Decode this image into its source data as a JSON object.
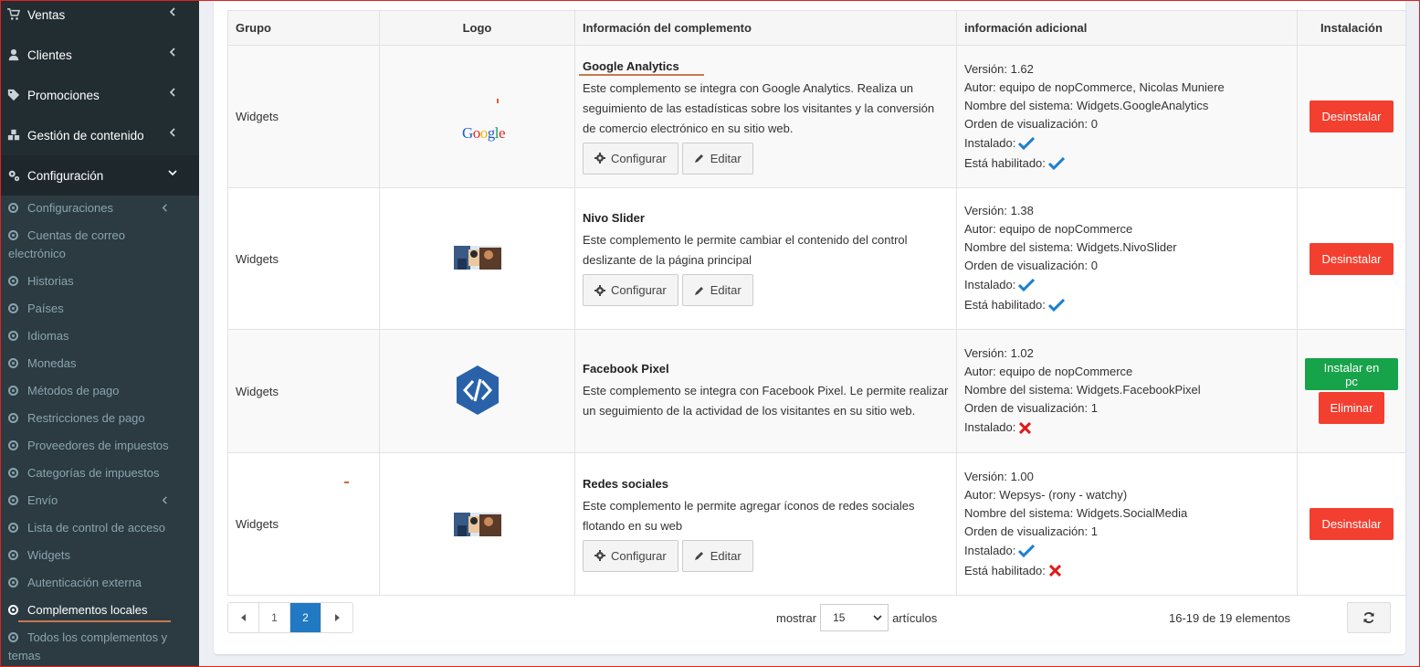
{
  "sidebar": {
    "top_items": [
      {
        "label": "Ventas",
        "icon": "cart-icon"
      },
      {
        "label": "Clientes",
        "icon": "user-icon"
      },
      {
        "label": "Promociones",
        "icon": "tag-icon"
      },
      {
        "label": "Gestión de contenido",
        "icon": "cubes-icon"
      },
      {
        "label": "Configuración",
        "icon": "gears-icon"
      }
    ],
    "sub_items": [
      {
        "label": "Configuraciones"
      },
      {
        "label": "Cuentas de correo electrónico"
      },
      {
        "label": "Historias"
      },
      {
        "label": "Países"
      },
      {
        "label": "Idiomas"
      },
      {
        "label": "Monedas"
      },
      {
        "label": "Métodos de pago"
      },
      {
        "label": "Restricciones de pago"
      },
      {
        "label": "Proveedores de impuestos"
      },
      {
        "label": "Categorías de impuestos"
      },
      {
        "label": "Envío"
      },
      {
        "label": "Lista de control de acceso"
      },
      {
        "label": "Widgets"
      },
      {
        "label": "Autenticación externa"
      },
      {
        "label": "Complementos locales"
      },
      {
        "label": "Todos los complementos y temas"
      }
    ]
  },
  "table": {
    "headers": [
      "Grupo",
      "Logo",
      "Información del complemento",
      "información adicional",
      "Instalación"
    ],
    "rows": [
      {
        "group": "Widgets",
        "logo": "google-logo",
        "logo_text": "Google",
        "name": "Google Analytics",
        "description": "Este complemento se integra con Google Analytics. Realiza un seguimiento de las estadísticas sobre los visitantes y la conversión de comercio electrónico en su sitio web.",
        "version": "Versión: 1.62",
        "author": "Autor: equipo de nopCommerce, Nicolas Muniere",
        "system_name": "Nombre del sistema: Widgets.GoogleAnalytics",
        "display_order": "Orden de visualización: 0",
        "installed_label": "Instalado:",
        "enabled_label": "Está habilitado:"
      },
      {
        "group": "Widgets",
        "logo": "nivo-slider-thumbnail",
        "name": "Nivo Slider",
        "description": "Este complemento le permite cambiar el contenido del control deslizante de la página principal",
        "version": "Versión: 1.38",
        "author": "Autor: equipo de nopCommerce",
        "system_name": "Nombre del sistema: Widgets.NivoSlider",
        "display_order": "Orden de visualización: 0",
        "installed_label": "Instalado:",
        "enabled_label": "Está habilitado:"
      },
      {
        "group": "Widgets",
        "logo": "code-hexagon-logo",
        "name": "Facebook Pixel",
        "description": "Este complemento se integra con Facebook Pixel. Le permite realizar un seguimiento de la actividad de los visitantes en su sitio web.",
        "version": "Versión: 1.02",
        "author": "Autor: equipo de nopCommerce",
        "system_name": "Nombre del sistema: Widgets.FacebookPixel",
        "display_order": "Orden de visualización: 1",
        "installed_label": "Instalado:"
      },
      {
        "group": "Widgets",
        "logo": "social-media-thumbnail",
        "name": "Redes sociales",
        "description": "Este complemento le permite agregar íconos de redes sociales flotando en su web",
        "version": "Versión: 1.00",
        "author": "Autor: Wepsys- (rony - watchy)",
        "system_name": "Nombre del sistema: Widgets.SocialMedia",
        "display_order": "Orden de visualización: 1",
        "installed_label": "Instalado:",
        "enabled_label": "Está habilitado:"
      }
    ],
    "buttons": {
      "configure": "Configurar",
      "edit": "Editar",
      "uninstall": "Desinstalar",
      "install": "Instalar en pc",
      "delete": "Eliminar"
    }
  },
  "pager": {
    "pages": [
      "1",
      "2"
    ],
    "current": "2",
    "show_label": "mostrar",
    "page_size": "15",
    "items_label": "artículos",
    "summary": "16-19 de 19 elementos"
  },
  "colors": {
    "sidebar_bg": "#222d32",
    "danger": "#f33f2f",
    "success": "#17a34a",
    "primary": "#2079c2",
    "check": "#1a7fd0",
    "cross": "#e01b1b"
  }
}
